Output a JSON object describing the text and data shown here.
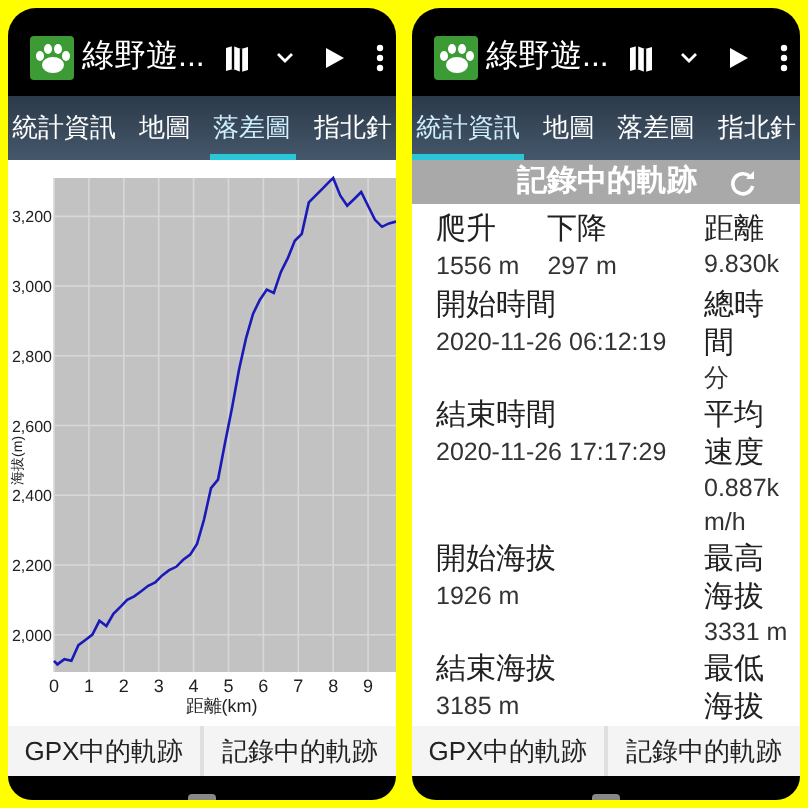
{
  "phones": [
    {
      "app_title": "綠野遊...",
      "tabs": [
        {
          "label": "統計資訊",
          "selected": false
        },
        {
          "label": "地圖",
          "selected": false
        },
        {
          "label": "落差圖",
          "selected": true
        },
        {
          "label": "指北針",
          "selected": false
        }
      ],
      "content": {
        "kind": "chart",
        "chart_data": {
          "type": "line",
          "xlabel": "距離(km)",
          "ylabel": "海拔(m)",
          "grid": true,
          "xlim": [
            0,
            9.8
          ],
          "ylim": [
            1893,
            3310
          ],
          "xticks": [
            0,
            1,
            2,
            3,
            4,
            5,
            6,
            7,
            8,
            9
          ],
          "yticks": [
            {
              "value": 2000,
              "label": "2,000"
            },
            {
              "value": 2200,
              "label": "2,200"
            },
            {
              "value": 2400,
              "label": "2,400"
            },
            {
              "value": 2600,
              "label": "2,600"
            },
            {
              "value": 2800,
              "label": "2,800"
            },
            {
              "value": 3000,
              "label": "3,000"
            },
            {
              "value": 3200,
              "label": "3,200"
            }
          ],
          "x": [
            0,
            0.1,
            0.3,
            0.5,
            0.7,
            0.9,
            1.1,
            1.3,
            1.5,
            1.7,
            1.9,
            2.1,
            2.3,
            2.5,
            2.7,
            2.9,
            3.1,
            3.3,
            3.5,
            3.7,
            3.9,
            4.1,
            4.3,
            4.5,
            4.7,
            4.9,
            5.1,
            5.3,
            5.5,
            5.7,
            5.9,
            6.1,
            6.3,
            6.5,
            6.7,
            6.9,
            7.1,
            7.3,
            7.5,
            7.7,
            7.9,
            8.0,
            8.2,
            8.4,
            8.6,
            8.8,
            9.0,
            9.2,
            9.4,
            9.6,
            9.8
          ],
          "series": [
            {
              "color": "#1a1ab8",
              "values": [
                1925,
                1915,
                1930,
                1925,
                1970,
                1985,
                2000,
                2040,
                2025,
                2060,
                2080,
                2100,
                2110,
                2125,
                2140,
                2150,
                2170,
                2185,
                2195,
                2215,
                2230,
                2260,
                2330,
                2420,
                2445,
                2550,
                2650,
                2760,
                2850,
                2920,
                2960,
                2990,
                2980,
                3040,
                3080,
                3130,
                3150,
                3240,
                3260,
                3280,
                3300,
                3310,
                3260,
                3230,
                3250,
                3270,
                3230,
                3190,
                3170,
                3180,
                3185
              ]
            }
          ]
        }
      },
      "bottom_buttons": [
        "GPX中的軌跡",
        "記錄中的軌跡"
      ]
    },
    {
      "app_title": "綠野遊...",
      "tabs": [
        {
          "label": "統計資訊",
          "selected": true
        },
        {
          "label": "地圖",
          "selected": false
        },
        {
          "label": "落差圖",
          "selected": false
        },
        {
          "label": "指北針",
          "selected": false
        }
      ],
      "content": {
        "kind": "stats",
        "header": "記錄中的軌跡",
        "rows": [
          {
            "left": [
              {
                "label": "爬升",
                "value": "1556 m"
              },
              {
                "label": "下降",
                "value": "297 m"
              }
            ],
            "right": {
              "label": "距離",
              "value": "9.830k"
            }
          },
          {
            "left": [
              {
                "label": "開始時間",
                "value": "2020-11-26 06:12:19"
              }
            ],
            "right": {
              "label": "總時間",
              "value": "分"
            }
          },
          {
            "left": [
              {
                "label": "結束時間",
                "value": "2020-11-26 17:17:29"
              }
            ],
            "right": {
              "label": "平均速度",
              "value": "0.887km/h"
            }
          },
          {
            "left": [
              {
                "label": "開始海拔",
                "value": "1926 m"
              }
            ],
            "right": {
              "label": "最高海拔",
              "value": "3331 m"
            }
          },
          {
            "left": [
              {
                "label": "結束海拔",
                "value": "3185 m"
              }
            ],
            "right": {
              "label": "最低海拔"
            }
          }
        ]
      },
      "bottom_buttons": [
        "GPX中的軌跡",
        "記錄中的軌跡"
      ]
    }
  ]
}
